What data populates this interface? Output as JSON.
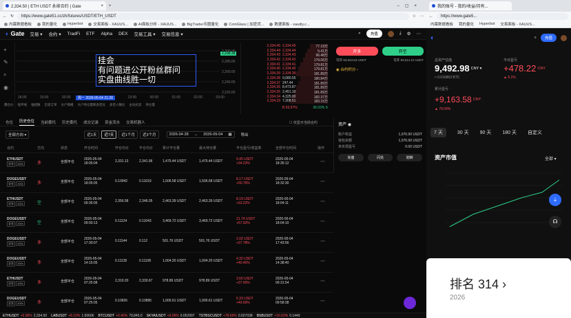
{
  "browser": {
    "tab_active": "2,334.50 | ETH USDT 永续合约 | Gate",
    "tab_inactive": "Gate",
    "url": "https://www.gate51.cc/zh/futures/USDT/ETH_USDT",
    "bookmarks": [
      "内幕数据看板",
      "我的量化",
      "Hyperbot",
      "交易面板 - XAUUS...",
      "AI面板分析 - XAUUS...",
      "BigTrader币圈量化",
      "CoinGlass | 加密货...",
      "数据面板 - xaudiy.c..."
    ]
  },
  "nav": {
    "logo": "Gate",
    "items": [
      "交易 ▾",
      "合约 ▾",
      "TradFi",
      "ETF",
      "Alpha",
      "DEX",
      "交易工具 ▾",
      "交易信息 ▾"
    ],
    "deposit": "充值"
  },
  "overlay": {
    "line1": "挂会",
    "line2": "有问题进公开粉丝群问",
    "line3": "实盘曲线胜一切"
  },
  "chart": {
    "price_tag": "2,298.38",
    "y_labels": [
      "2,300.00",
      "2,280.00",
      "2,260.00",
      "2,240.00",
      "2,220.00"
    ],
    "x_labels": [
      "18:00",
      "19:00",
      "20:00",
      "21:00",
      "22:00",
      "23:00",
      "00:00",
      "01:00",
      "02:00",
      "03:00"
    ],
    "cursor_time": "周一 2026-05-04 21:28",
    "toolbar_items": [
      "爆仓价",
      "强平线",
      "强招数",
      "历史订单",
      "大户情绪",
      "大户持仓量和多空比",
      "多空人数比",
      "主动买卖",
      "持仓量"
    ]
  },
  "orderbook": {
    "asks": [
      [
        "2,334.45",
        "77.19万"
      ],
      [
        "2,334.44",
        "5.41万"
      ],
      [
        "2,334.43",
        "96.48万"
      ],
      [
        "2,334.42",
        "179.06万"
      ],
      [
        "2,334.41",
        "179.81万"
      ],
      [
        "2,334.40",
        "179.81万"
      ],
      [
        "2,334.39",
        "181.89万"
      ]
    ],
    "bids": [
      [
        "2,334.38",
        "9,080.55"
      ],
      [
        "2,334.37",
        "247.44"
      ],
      [
        "2,334.36",
        "8,473.87"
      ],
      [
        "2,334.35",
        "2,451.10"
      ],
      [
        "2,334.34",
        "4,325.00"
      ],
      [
        "2,334.33",
        "7,308.51"
      ]
    ],
    "bid_vals": [
      "180.84万",
      "181.89万",
      "181.89万",
      "181.89万",
      "182.37万",
      "183.15万"
    ],
    "ratio_buy": "B 63.97%",
    "ratio_sell": "36.03% S"
  },
  "trade": {
    "open_long": "开多",
    "open_short": "开空",
    "avail_long": "可开 93,643.63 USDT",
    "avail_short": "可开 93,514.10 USDT",
    "points": "合约积分"
  },
  "tabs": [
    "仓位",
    "历史仓位",
    "当前委托",
    "历史委托",
    "成交记录",
    "资金流水",
    "交易机器人"
  ],
  "tab_right": "仅显示当前合约",
  "filters": {
    "side": "全部方向 ▾",
    "ranges": [
      "近1天",
      "近7天",
      "近1个月",
      "近3个月"
    ],
    "date_from": "2026-04-28",
    "date_to": "2026-05-04",
    "export": "导出"
  },
  "columns": [
    "合约",
    "方向",
    "状态",
    "开仓时间",
    "开仓均价",
    "平仓均价",
    "累计平仓量",
    "最大持仓量",
    "平仓盈亏/收益率",
    "全部平仓时间",
    "操作"
  ],
  "rows": [
    {
      "sym": "ETHUSDT",
      "dir": "多",
      "status": "全部平仓",
      "open": "2026-05-04",
      "opent": "18:05:04",
      "openp": "2,331.13",
      "closep": "2,341.96",
      "vol": "1,475.44 USDT",
      "max": "1,475.44 USDT",
      "pnl": "5.45 USDT",
      "pct": "+34.23%",
      "close": "2026-05-04",
      "closet": "18:35:12",
      "dirc": "red"
    },
    {
      "sym": "DOGEUSDT",
      "dir": "多",
      "status": "全部平仓",
      "open": "2026-05-04",
      "opent": "18:05:05",
      "openp": "0.10942",
      "closep": "0.11019",
      "vol": "1,506.58 USDT",
      "max": "1,506.58 USDT",
      "pnl": "8.17 USDT",
      "pct": "+50.79%",
      "close": "2026-05-04",
      "closet": "18:32:30",
      "dirc": "red"
    },
    {
      "sym": "ETHUSDT",
      "dir": "空",
      "status": "全部平仓",
      "open": "2026-05-04",
      "opent": "09:35:05",
      "openp": "2,356.58",
      "closep": "2,346.05",
      "vol": "2,463.39 USDT",
      "max": "2,463.39 USDT",
      "pnl": "8.19 USDT",
      "pct": "+33.22%",
      "close": "2026-05-04",
      "closet": "18:04:11",
      "dirc": "green"
    },
    {
      "sym": "DOGEUSDT",
      "dir": "空",
      "status": "全部平仓",
      "open": "2026-05-04",
      "opent": "09:00:13",
      "openp": "0.11124",
      "closep": "0.11043",
      "vol": "3,469.72 USDT",
      "max": "3,469.72 USDT",
      "pnl": "21.74 USDT",
      "pct": "+57.92%",
      "close": "2026-05-04",
      "closet": "18:04:10",
      "dirc": "green"
    },
    {
      "sym": "DOGEUSDT",
      "dir": "多",
      "status": "全部平仓",
      "open": "2026-05-04",
      "opent": "17:30:07",
      "openp": "0.11144",
      "closep": "0.112",
      "vol": "501.76 USDT",
      "max": "501.76 USDT",
      "pnl": "2.02 USDT",
      "pct": "+37.78%",
      "close": "2026-05-04",
      "closet": "17:43:56",
      "dirc": "red"
    },
    {
      "sym": "DOGEUSDT",
      "dir": "多",
      "status": "全部平仓",
      "open": "2026-05-04",
      "opent": "14:15:05",
      "openp": "0.11135",
      "closep": "0.11195",
      "vol": "1,004.20 USDT",
      "max": "1,004.20 USDT",
      "pnl": "4.32 USDT",
      "pct": "+40.40%",
      "close": "2026-05-04",
      "closet": "14:38:40",
      "dirc": "red"
    },
    {
      "sym": "ETHUSDT",
      "dir": "多",
      "status": "全部平仓",
      "open": "2026-05-04",
      "opent": "07:25:08",
      "openp": "2,319.20",
      "closep": "2,330.67",
      "vol": "978.89 USDT",
      "max": "978.89 USDT",
      "pnl": "3.60 USDT",
      "pct": "+37.45%",
      "close": "2026-05-04",
      "closet": "09:31:54",
      "dirc": "red"
    },
    {
      "sym": "DOGEUSDT",
      "dir": "多",
      "status": "全部平仓",
      "open": "2026-05-04",
      "opent": "07:25:05",
      "openp": "0.10826",
      "closep": "0.10895",
      "vol": "1,005.61 USDT",
      "max": "1,005.61 USDT",
      "pnl": "5.33 USDT",
      "pct": "+49.69%",
      "close": "2026-05-04",
      "closet": "09:58:38",
      "dirc": "red"
    }
  ],
  "assets": {
    "title": "资产",
    "rows": [
      [
        "账户权益",
        "1,076.90 USDT"
      ],
      [
        "钱包余额",
        "1,076.90 USDT"
      ],
      [
        "未实现盈亏",
        "0.00 USDT"
      ]
    ],
    "buttons": [
      "充值",
      "闪兑",
      "划转"
    ]
  },
  "ticker": [
    {
      "s": "ETHUSDT",
      "c": "+0.96%",
      "p": "2,334.50"
    },
    {
      "s": "LABUSDT",
      "c": "+8.10%",
      "p": "1.50606"
    },
    {
      "s": "BTCUSDT",
      "c": "+0.45%",
      "p": "79,845.0"
    },
    {
      "s": "SKYAIUSDT",
      "c": "+9.06%",
      "p": "0.052997"
    },
    {
      "s": "TSTBSCUSDT",
      "c": "+78.66%",
      "p": "0.027038"
    },
    {
      "s": "BSBUSDT",
      "c": "+16.63%",
      "p": "0.1449"
    }
  ],
  "right": {
    "tab": "我的账号 - 我的/收益/持有...",
    "url": "https://www.gate5...",
    "deposit": "充值",
    "total_label": "总资产估值",
    "total": "9,492.98",
    "total_unit": "CNY ▾",
    "btc": "≈ 0.016863 BTC",
    "today_label": "今日盈亏",
    "today": "+478.22",
    "today_unit": "CNY",
    "today_pct": "▲ 5.1%",
    "cum_label": "累计盈亏",
    "cum": "+9,163.58",
    "cum_unit": "CNY",
    "cum_pct": "▲ 79.09%",
    "periods": [
      "7 天",
      "30 天",
      "90 天",
      "180 天",
      "自定义"
    ],
    "market_title": "资产市值",
    "market_filter": "全部 ▾",
    "rank_label": "排名 314",
    "rank_year": "2026"
  }
}
